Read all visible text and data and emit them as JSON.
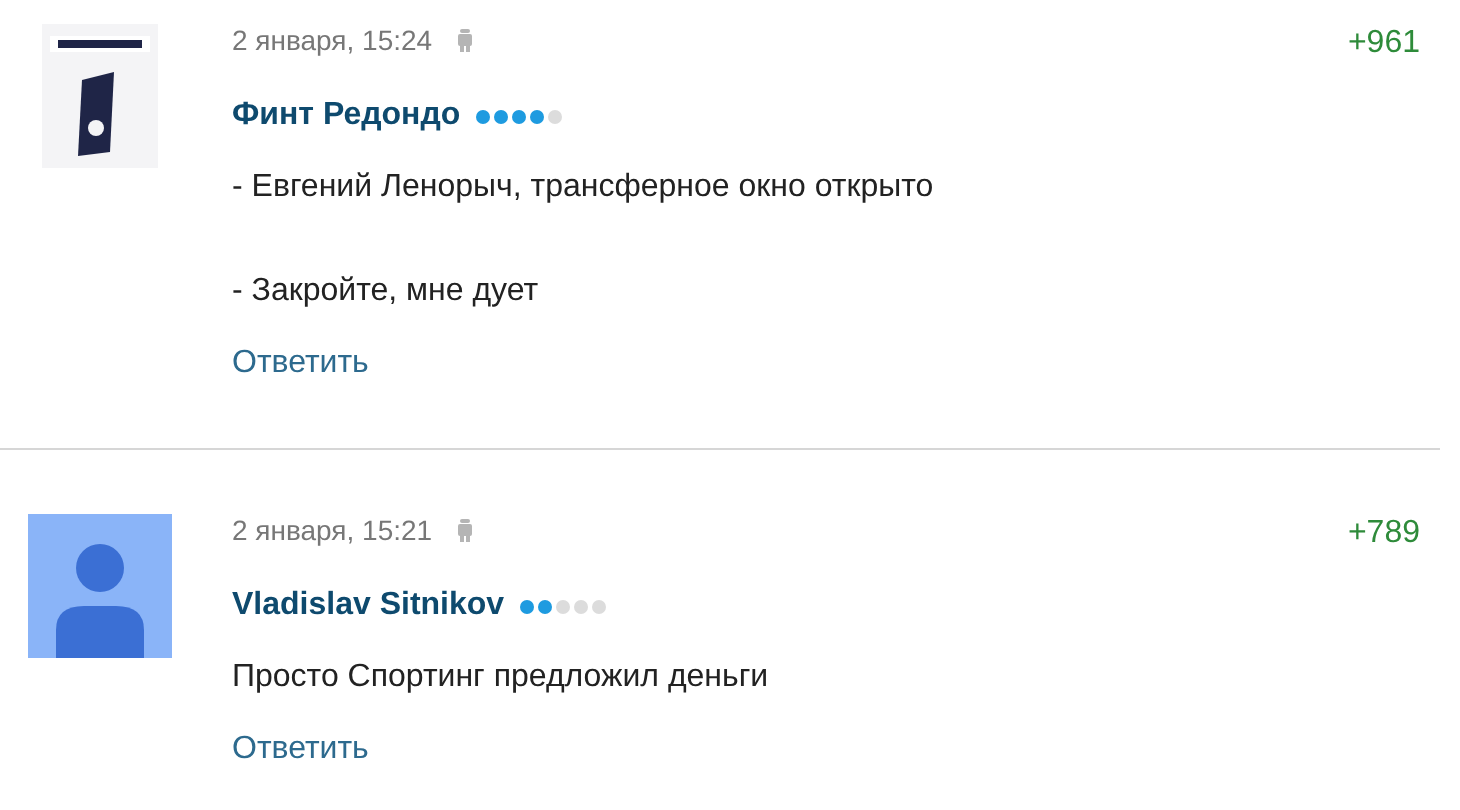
{
  "comments": [
    {
      "date": "2 января, 15:24",
      "author": "Финт Редондо",
      "stars": 4,
      "paragraphs": [
        "- Евгений Ленорыч, трансферное окно открыто",
        "- Закройте, мне дует"
      ],
      "reply": "Ответить",
      "score": "+961"
    },
    {
      "avatar": {
        "kind": "silhouette"
      },
      "date": "2 января, 15:21",
      "author": "Vladislav Sitnikov",
      "stars": 2,
      "paragraphs": [
        "Просто Спортинг предложил деньги"
      ],
      "reply": "Ответить",
      "score": "+789"
    }
  ]
}
